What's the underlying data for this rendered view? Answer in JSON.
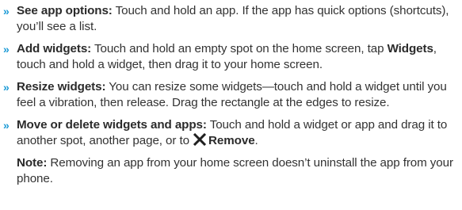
{
  "bullet_symbol": "»",
  "items": [
    {
      "title": "See app options:",
      "text": " Touch and hold an app. If the app has quick options (shortcuts), you’ll see a list."
    },
    {
      "title": "Add widgets:",
      "text_before": " Touch and hold an empty spot on the home screen, tap ",
      "inline_bold": "Widgets",
      "text_after": ", touch and hold a widget, then drag it to your home screen."
    },
    {
      "title": "Resize widgets:",
      "text": " You can resize some widgets—touch and hold a widget until you feel a vibration, then release. Drag the rectangle at the edges to resize."
    },
    {
      "title": "Move or delete widgets and apps:",
      "text": " Touch and hold a widget or app and drag it to another spot, another page, or to ",
      "icon": "close-x-icon",
      "remove_label": "Remove",
      "end": "."
    }
  ],
  "note": {
    "label": "Note:",
    "text": " Removing an app from your home screen doesn’t uninstall the app from your phone."
  }
}
